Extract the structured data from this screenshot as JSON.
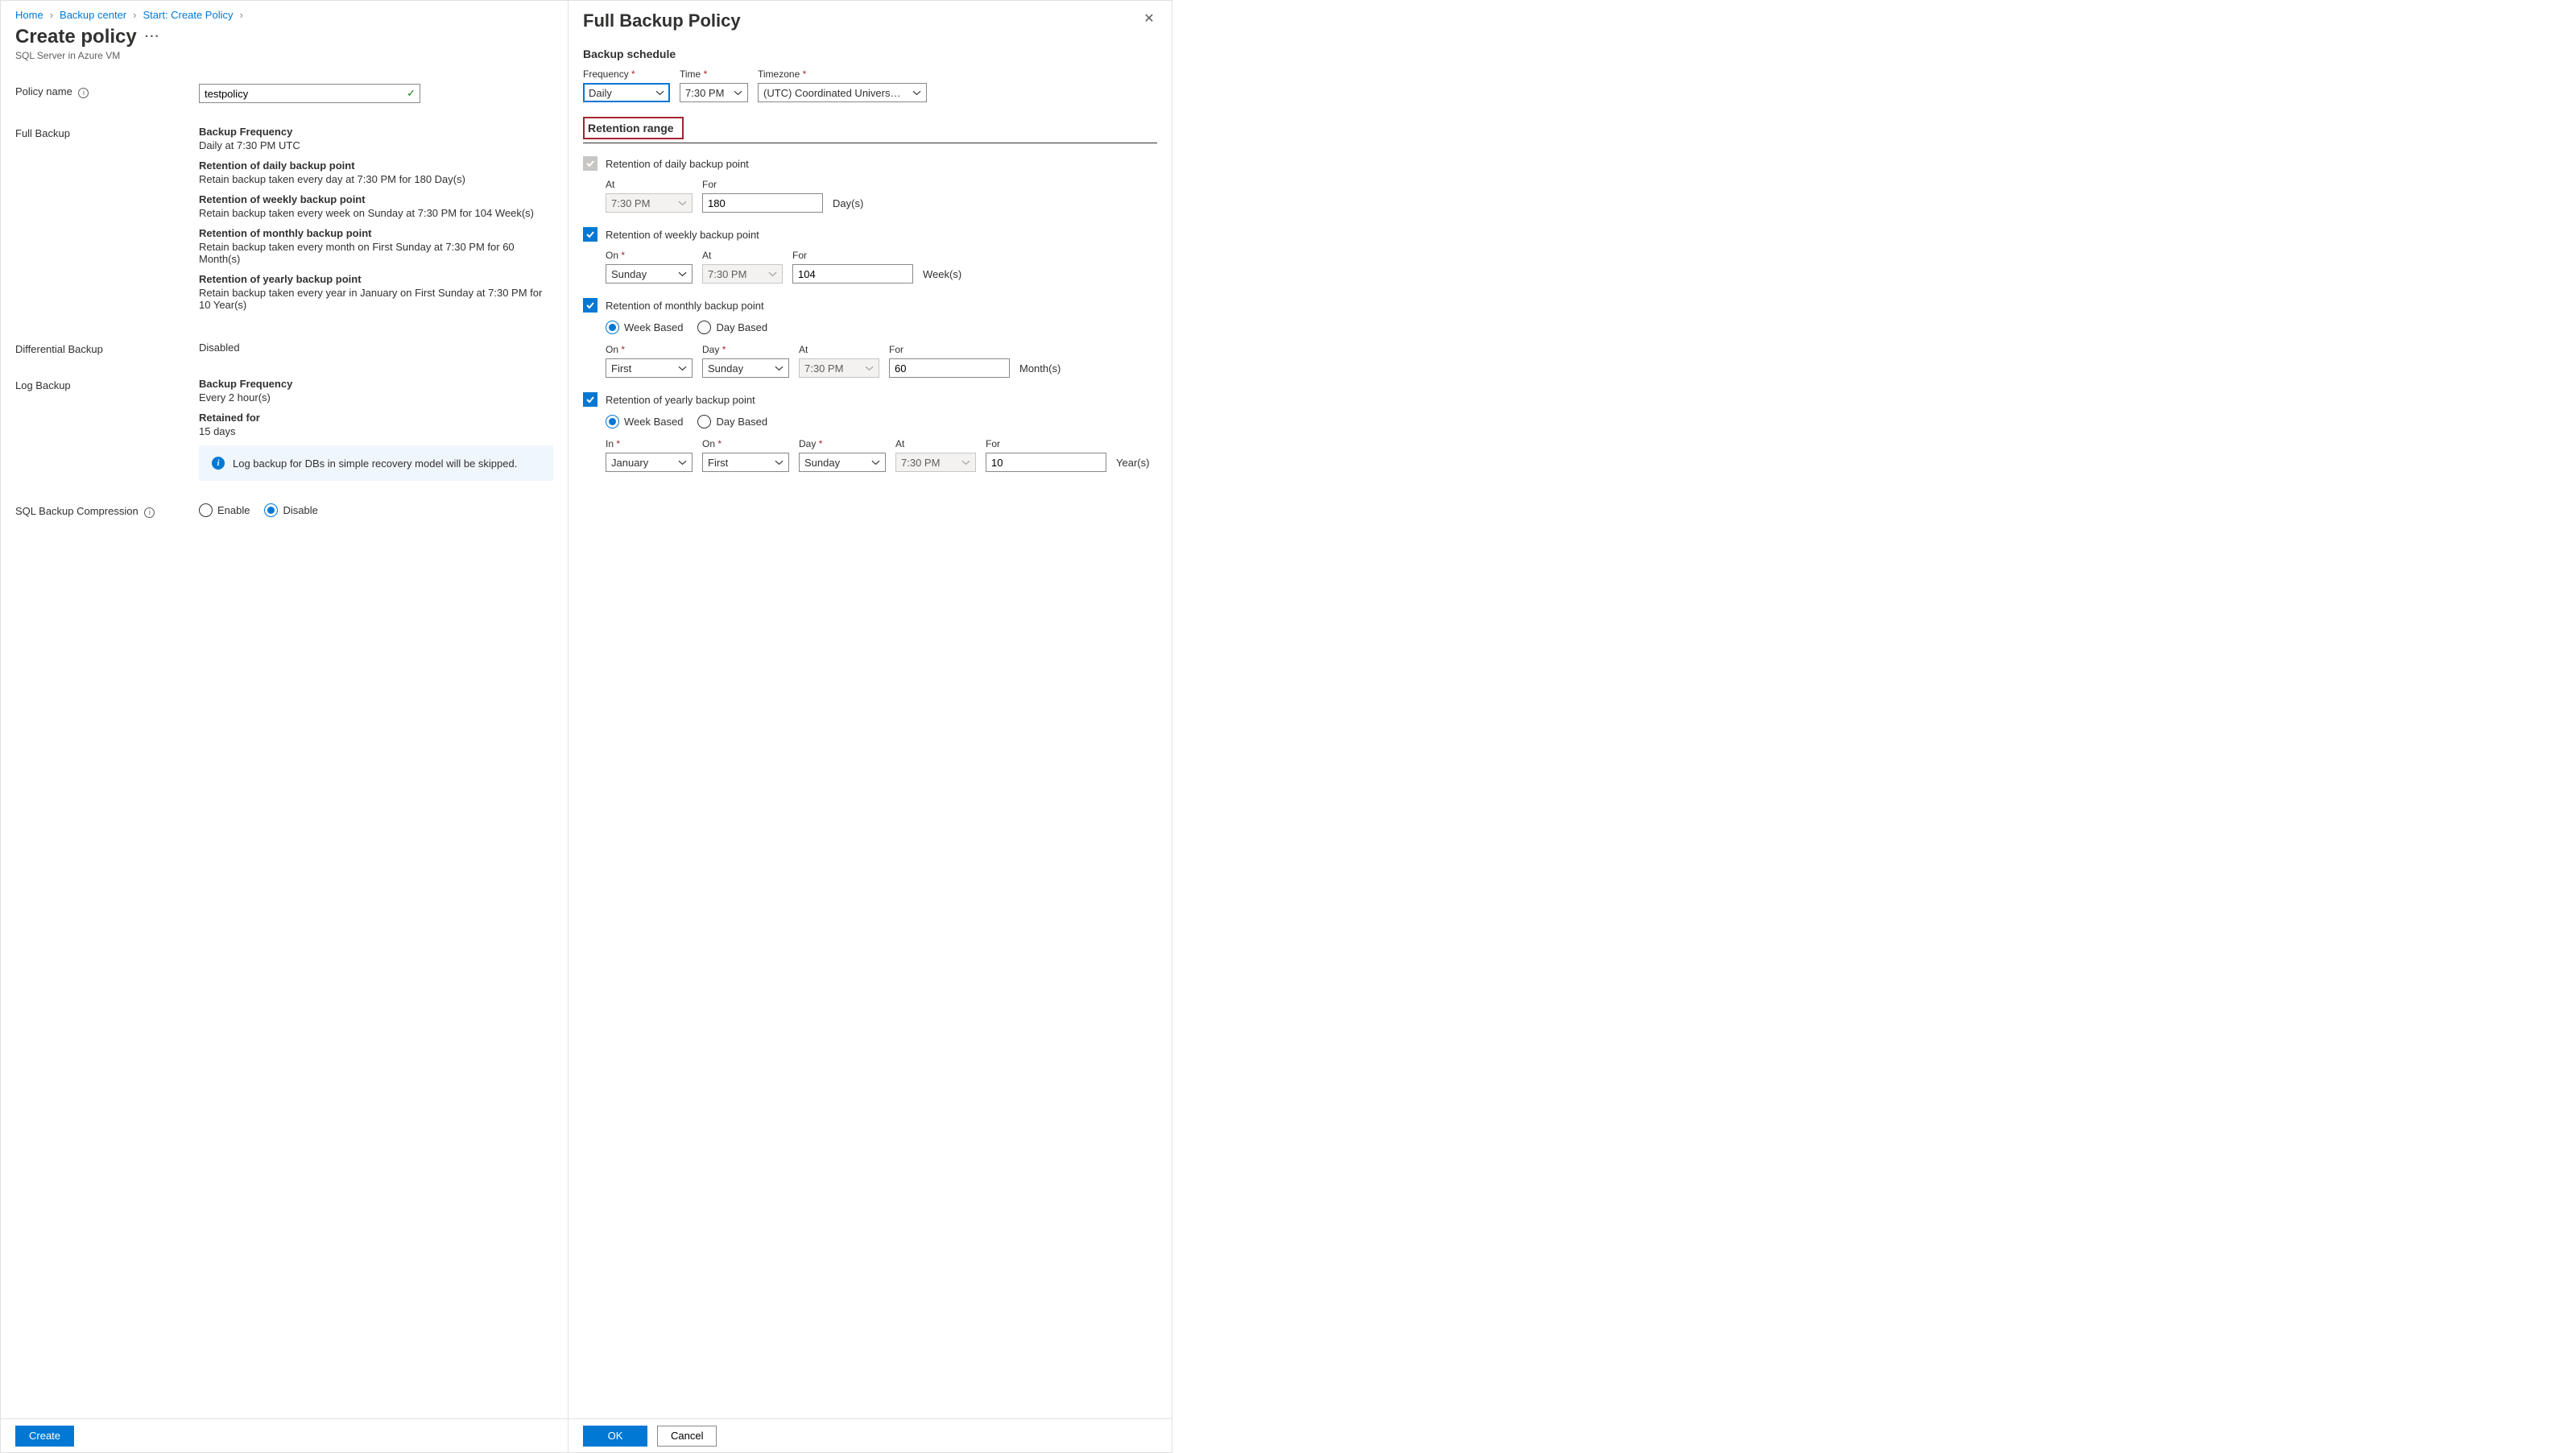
{
  "breadcrumb": {
    "items": [
      "Home",
      "Backup center",
      "Start: Create Policy"
    ]
  },
  "left": {
    "title": "Create policy",
    "subtitle": "SQL Server in Azure VM",
    "policyNameLabel": "Policy name",
    "policyNameValue": "testpolicy",
    "fullBackupLabel": "Full Backup",
    "fullBackup": {
      "freqH": "Backup Frequency",
      "freqV": "Daily at 7:30 PM UTC",
      "dailyH": "Retention of daily backup point",
      "dailyV": "Retain backup taken every day at 7:30 PM for 180 Day(s)",
      "weeklyH": "Retention of weekly backup point",
      "weeklyV": "Retain backup taken every week on Sunday at 7:30 PM for 104 Week(s)",
      "monthlyH": "Retention of monthly backup point",
      "monthlyV": "Retain backup taken every month on First Sunday at 7:30 PM for 60 Month(s)",
      "yearlyH": "Retention of yearly backup point",
      "yearlyV": "Retain backup taken every year in January on First Sunday at 7:30 PM for 10 Year(s)"
    },
    "diffLabel": "Differential Backup",
    "diffValue": "Disabled",
    "logLabel": "Log Backup",
    "log": {
      "freqH": "Backup Frequency",
      "freqV": "Every 2 hour(s)",
      "retH": "Retained for",
      "retV": "15 days"
    },
    "logNotice": "Log backup for DBs in simple recovery model will be skipped.",
    "compressionLabel": "SQL Backup Compression",
    "compressionEnable": "Enable",
    "compressionDisable": "Disable",
    "createBtn": "Create"
  },
  "right": {
    "title": "Full Backup Policy",
    "scheduleH": "Backup schedule",
    "freqLabel": "Frequency",
    "freqValue": "Daily",
    "timeLabel": "Time",
    "timeValue": "7:30 PM",
    "tzLabel": "Timezone",
    "tzValue": "(UTC) Coordinated Universal Time",
    "retentionH": "Retention range",
    "daily": {
      "title": "Retention of daily backup point",
      "atL": "At",
      "atV": "7:30 PM",
      "forL": "For",
      "forV": "180",
      "unit": "Day(s)"
    },
    "weekly": {
      "title": "Retention of weekly backup point",
      "onL": "On",
      "onV": "Sunday",
      "atL": "At",
      "atV": "7:30 PM",
      "forL": "For",
      "forV": "104",
      "unit": "Week(s)"
    },
    "monthly": {
      "title": "Retention of monthly backup point",
      "weekBased": "Week Based",
      "dayBased": "Day Based",
      "onL": "On",
      "onV": "First",
      "dayL": "Day",
      "dayV": "Sunday",
      "atL": "At",
      "atV": "7:30 PM",
      "forL": "For",
      "forV": "60",
      "unit": "Month(s)"
    },
    "yearly": {
      "title": "Retention of yearly backup point",
      "weekBased": "Week Based",
      "dayBased": "Day Based",
      "inL": "In",
      "inV": "January",
      "onL": "On",
      "onV": "First",
      "dayL": "Day",
      "dayV": "Sunday",
      "atL": "At",
      "atV": "7:30 PM",
      "forL": "For",
      "forV": "10",
      "unit": "Year(s)"
    },
    "okBtn": "OK",
    "cancelBtn": "Cancel"
  }
}
